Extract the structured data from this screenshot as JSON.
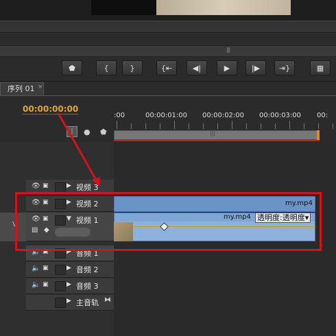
{
  "transport": {
    "buttons": [
      {
        "name": "add-marker-button",
        "glyph": "⬟"
      },
      {
        "name": "set-in-button",
        "glyph": "{"
      },
      {
        "name": "set-out-button",
        "glyph": "}"
      },
      {
        "name": "go-to-in-button",
        "glyph": "{⇤"
      },
      {
        "name": "step-back-button",
        "glyph": "◀|"
      },
      {
        "name": "play-button",
        "glyph": "▶"
      },
      {
        "name": "step-forward-button",
        "glyph": "|▶"
      },
      {
        "name": "go-to-out-button",
        "glyph": "⇥}"
      },
      {
        "name": "export-frame-button",
        "glyph": "▦"
      }
    ]
  },
  "sequence": {
    "tab_label": "序列 01",
    "close": "×",
    "timecode": "00:00:00:00"
  },
  "ruler": {
    "labels": [
      ":00",
      "00:00:01:00",
      "00:00:02:00",
      "00:00:03:00",
      "00:"
    ]
  },
  "tracks": {
    "video": [
      {
        "label": "视频 3"
      },
      {
        "label": "视频 2"
      },
      {
        "label": "视频 1"
      }
    ],
    "audio": [
      {
        "label": "音频 1"
      },
      {
        "label": "音频 2"
      },
      {
        "label": "音频 3"
      }
    ],
    "master": "主音轨",
    "left_target": "V"
  },
  "clips": {
    "v2_name": "my.mp4",
    "v1_name": "my.mp4",
    "v1_effect": "透明度:透明度▾"
  },
  "colors": {
    "timecode": "#e4a52c",
    "clip": "#8db1dc",
    "annotation": "#d4121b"
  }
}
